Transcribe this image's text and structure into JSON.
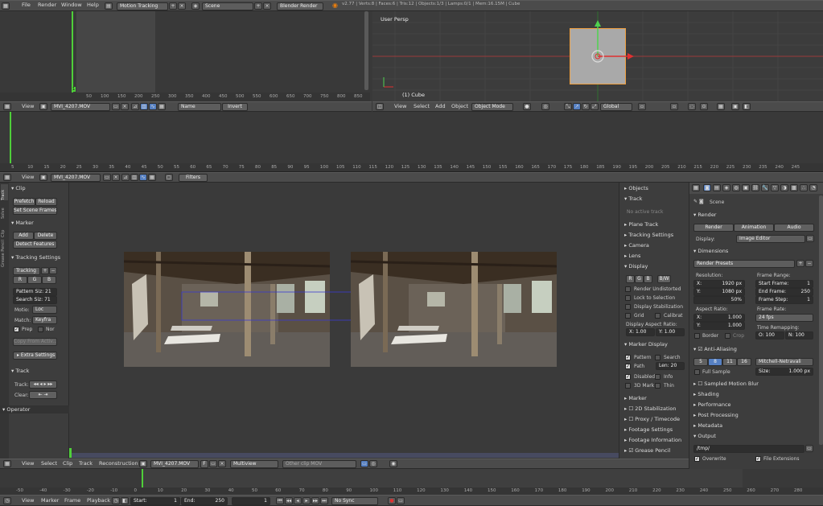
{
  "topbar": {
    "menus": [
      "File",
      "Render",
      "Window",
      "Help"
    ],
    "screen": "Motion Tracking",
    "scene": "Scene",
    "engine": "Blender Render",
    "stats": "v2.77 | Verts:8 | Faces:6 | Tris:12 | Objects:1/3 | Lamps:0/1 | Mem:16.15M | Cube"
  },
  "graph": {
    "ticks": [
      "50",
      "100",
      "150",
      "200",
      "250",
      "300",
      "350",
      "400",
      "450",
      "500",
      "550",
      "600",
      "650",
      "700",
      "750",
      "800",
      "850"
    ],
    "frame": "1"
  },
  "graph_header": {
    "view": "View",
    "clip": "MVI_4207.MOV",
    "name": "Name",
    "invert": "Invert"
  },
  "viewport": {
    "label": "User Persp",
    "object": "(1) Cube",
    "menus": [
      "View",
      "Select",
      "Add",
      "Object"
    ],
    "mode": "Object Mode",
    "orient": "Global"
  },
  "dopesheet": {
    "ticks": [
      "5",
      "10",
      "15",
      "20",
      "25",
      "30",
      "35",
      "40",
      "45",
      "50",
      "55",
      "60",
      "65",
      "70",
      "75",
      "80",
      "85",
      "90",
      "95",
      "100",
      "105",
      "110",
      "115",
      "120",
      "125",
      "130",
      "135",
      "140",
      "145",
      "150",
      "155",
      "160",
      "165",
      "170",
      "175",
      "180",
      "185",
      "190",
      "195",
      "200",
      "205",
      "210",
      "215",
      "220",
      "225",
      "230",
      "235",
      "240",
      "245"
    ],
    "view": "View",
    "clip": "MVI_4207.MOV",
    "filters": "Filters"
  },
  "tools": {
    "tabs": [
      "Track",
      "Solve",
      "Clip",
      "Grease Pencil"
    ],
    "clip_h": "Clip",
    "prefetch": "Prefetch",
    "reload": "Reload",
    "set_scene_frames": "Set Scene Frames",
    "marker_h": "Marker",
    "add": "Add",
    "delete": "Delete",
    "detect": "Detect Features",
    "ts_h": "Tracking Settings",
    "tracking": "Tracking",
    "r": "R",
    "g": "G",
    "b": "B",
    "pattern": "Pattern Siz: 21",
    "search": "Search Siz: 71",
    "motion_l": "Motio:",
    "motion": "Loc",
    "match_l": "Match:",
    "match": "Keyfra",
    "prepass": "Prep",
    "normalize": "Nor",
    "copy": "Copy From Activ...",
    "extra": "Extra Settings",
    "track_h": "Track",
    "track_l": "Track:",
    "clear_l": "Clear:",
    "operator": "Operator"
  },
  "clip_props": {
    "objects": "Objects",
    "track": "Track",
    "no_active": "No active track",
    "plane": "Plane Track",
    "ts": "Tracking Settings",
    "camera": "Camera",
    "lens": "Lens",
    "display": "Display",
    "r": "R",
    "g": "G",
    "b": "B",
    "bw": "B/W",
    "render_undistorted": "Render Undistorted",
    "lock": "Lock to Selection",
    "display_stab": "Display Stabilization",
    "grid": "Grid",
    "calibration": "Calibrat",
    "aspect": "Display Aspect Ratio:",
    "ax": "X: 1.00",
    "ay": "Y: 1.00",
    "marker_display": "Marker Display",
    "pattern": "Pattern",
    "search": "Search",
    "path": "Path",
    "len": "Len: 20",
    "disabled": "Disabled",
    "info": "Info",
    "mark3d": "3D Mark",
    "thin": "Thin",
    "marker": "Marker",
    "stab2d": "2D Stabilization",
    "proxy": "Proxy / Timecode",
    "footage_settings": "Footage Settings",
    "footage_info": "Footage Information",
    "grease": "Grease Pencil"
  },
  "render": {
    "scene": "Scene",
    "render_h": "Render",
    "render_b": "Render",
    "anim_b": "Animation",
    "audio_b": "Audio",
    "display_l": "Display:",
    "display": "Image Editor",
    "dims_h": "Dimensions",
    "presets": "Render Presets",
    "res_l": "Resolution:",
    "rx": "X:",
    "rx_v": "1920 px",
    "ry": "Y:",
    "ry_v": "1080 px",
    "pct": "50%",
    "fr_l": "Frame Range:",
    "start": "Start Frame:",
    "start_v": "1",
    "end": "End Frame:",
    "end_v": "250",
    "step": "Frame Step:",
    "step_v": "1",
    "asp_l": "Aspect Ratio:",
    "ax": "X:",
    "ax_v": "1.000",
    "ay": "Y:",
    "ay_v": "1.000",
    "rate_l": "Frame Rate:",
    "rate": "24 fps",
    "border": "Border",
    "crop": "Crop",
    "remap_l": "Time Remapping:",
    "remap_o": "O: 100",
    "remap_n": "N: 100",
    "aa_h": "Anti-Aliasing",
    "aa": [
      "5",
      "8",
      "11",
      "16"
    ],
    "filter": "Mitchell-Netravali",
    "full": "Full Sample",
    "size": "Size:",
    "size_v": "1.000 px",
    "smb": "Sampled Motion Blur",
    "shading": "Shading",
    "perf": "Performance",
    "post": "Post Processing",
    "meta": "Metadata",
    "output": "Output",
    "path": "/tmp/",
    "overwrite": "Overwrite",
    "ext": "File Extensions"
  },
  "clip_header": {
    "menus": [
      "View",
      "Select",
      "Clip",
      "Track",
      "Reconstruction"
    ],
    "clip": "MVI_4207.MOV",
    "f": "F",
    "multiview": "Multiview",
    "other": "Other clip MOV"
  },
  "timeline": {
    "ticks": [
      "-50",
      "-40",
      "-30",
      "-20",
      "-10",
      "0",
      "10",
      "20",
      "30",
      "40",
      "50",
      "60",
      "70",
      "80",
      "90",
      "100",
      "110",
      "120",
      "130",
      "140",
      "150",
      "160",
      "170",
      "180",
      "190",
      "200",
      "210",
      "220",
      "230",
      "240",
      "250",
      "260",
      "270",
      "280"
    ],
    "menus": [
      "View",
      "Marker",
      "Frame",
      "Playback"
    ],
    "start": "Start:",
    "start_v": "1",
    "end": "End:",
    "end_v": "250",
    "cur": "1",
    "sync": "No Sync"
  },
  "colors": {
    "bg": "#393939",
    "header": "#4b4b4b",
    "accent": "#5680c2",
    "green": "#4fcf3a"
  }
}
